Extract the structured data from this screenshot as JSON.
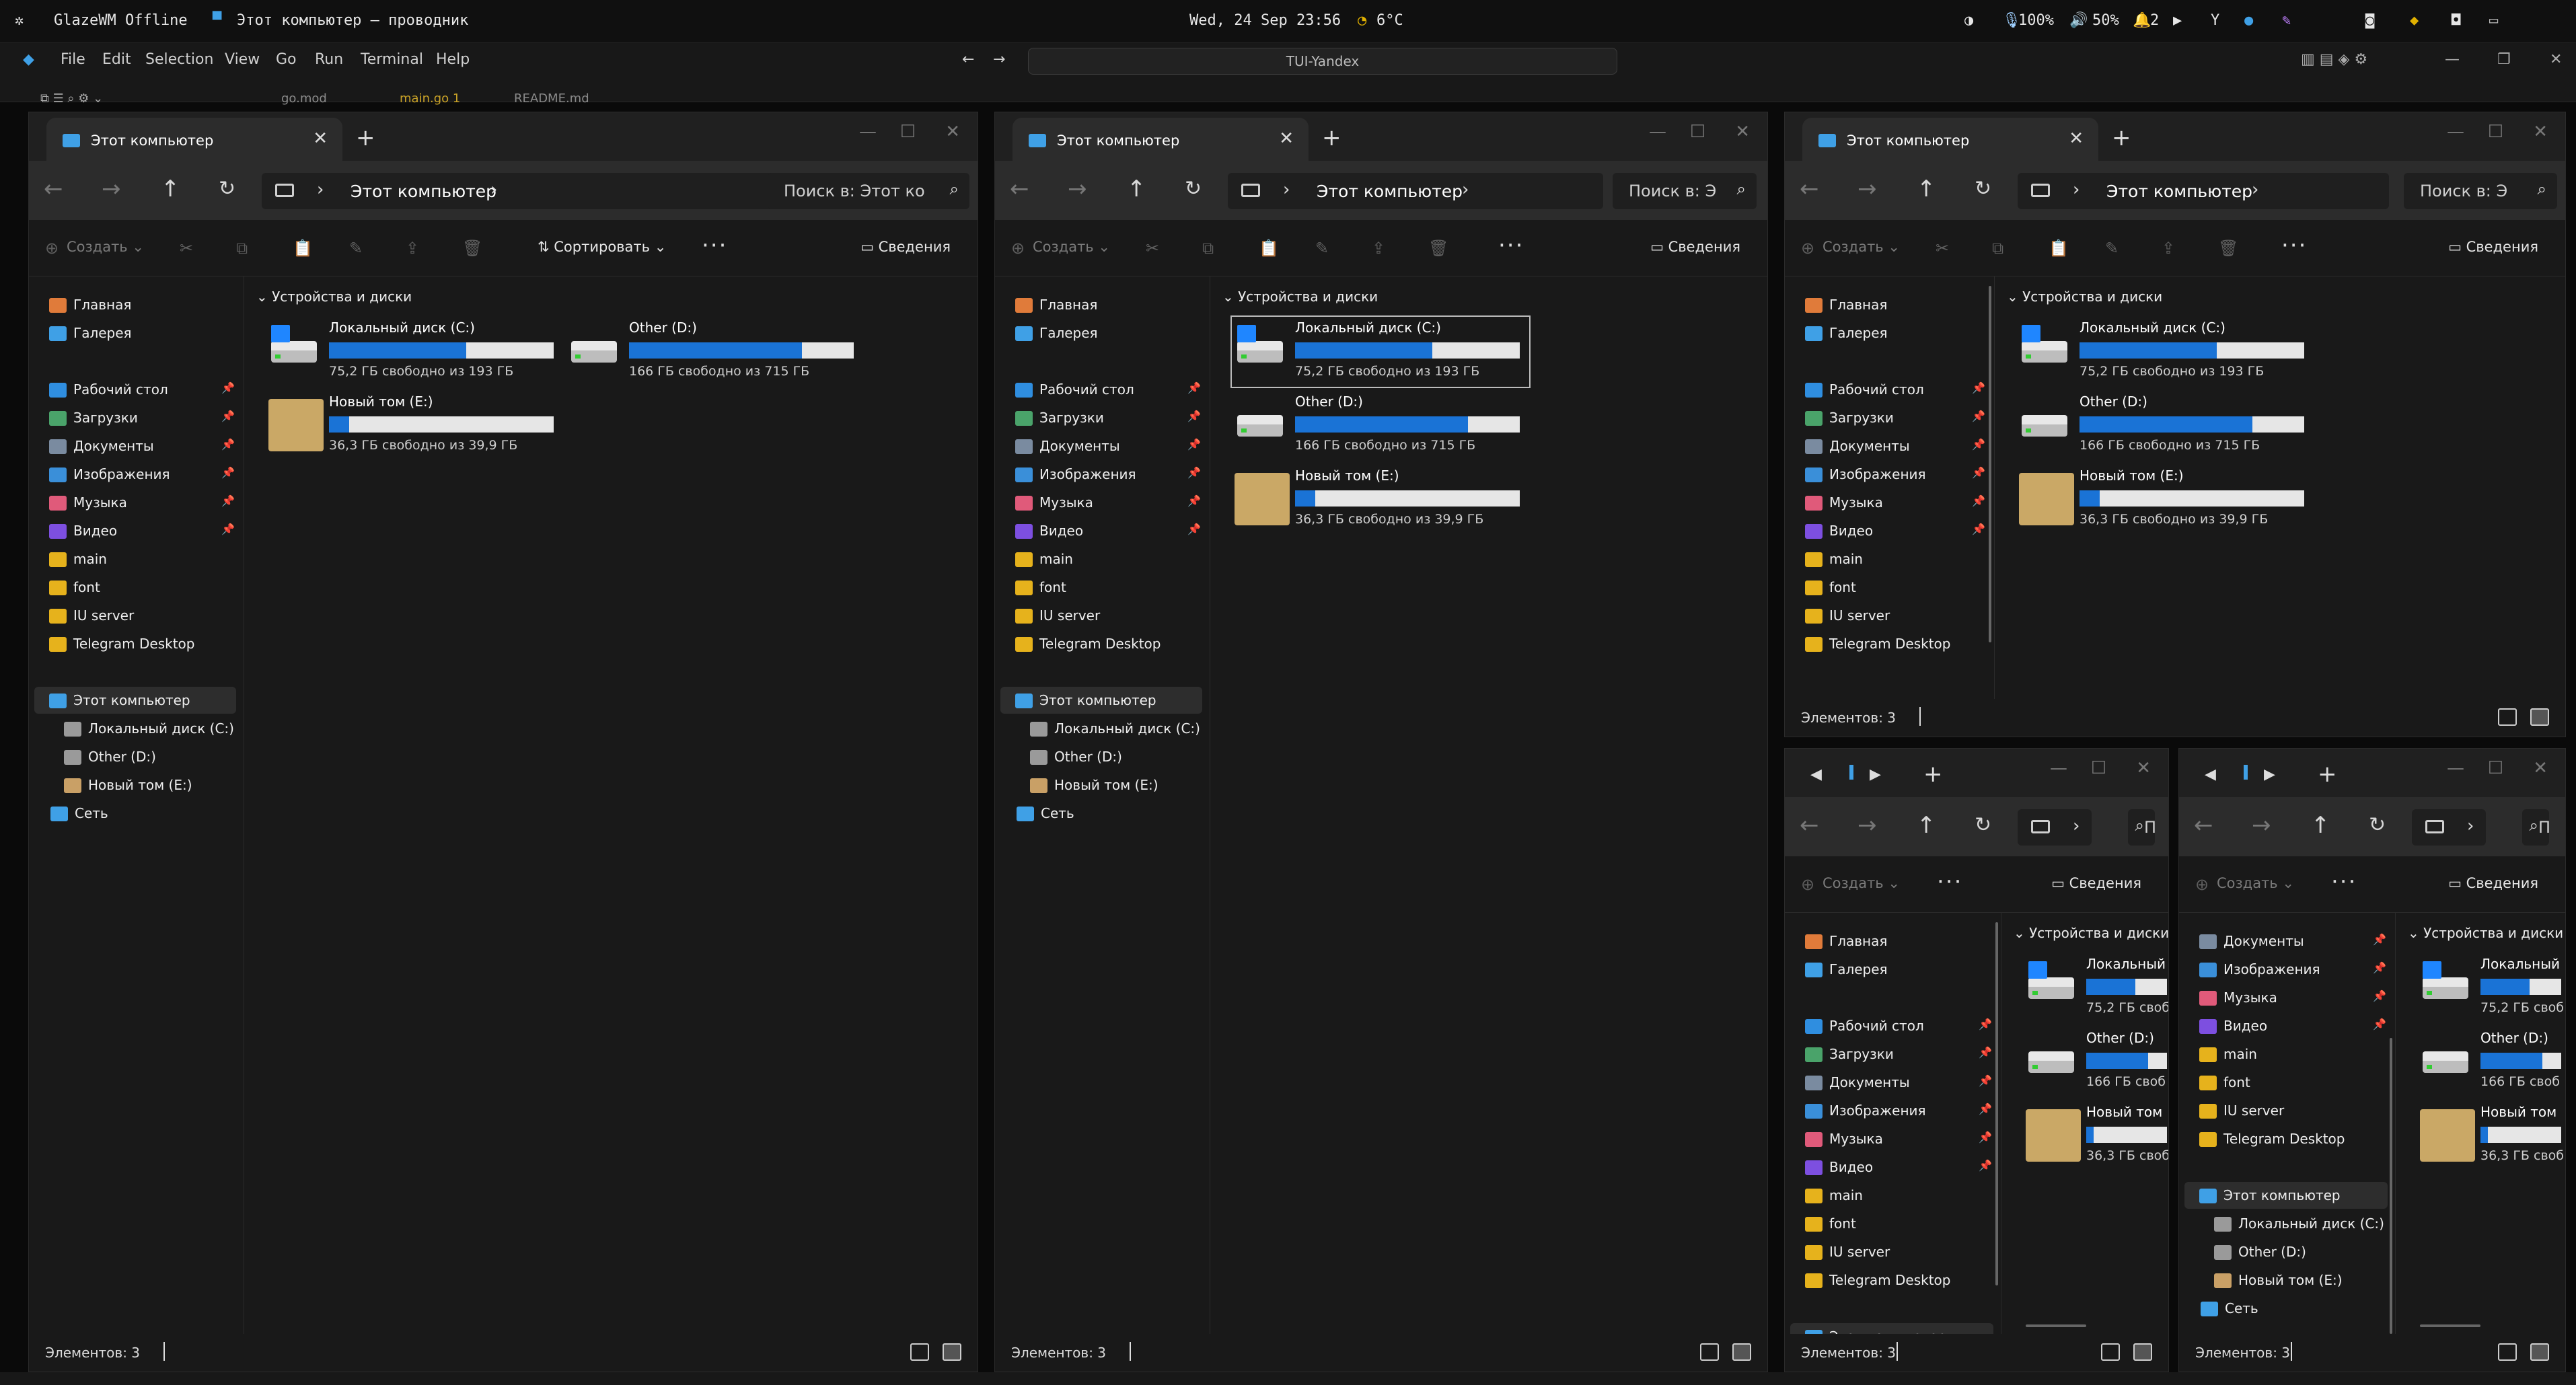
{
  "topbar": {
    "glaze": "GlazeWM Offline",
    "window_title": "Этот компьютер — проводник",
    "datetime": "Wed, 24 Sep 23:56",
    "weather": "6°C",
    "mic": "100%",
    "volume": "50%",
    "notifications": "2"
  },
  "vscode": {
    "menu": [
      "File",
      "Edit",
      "Selection",
      "View",
      "Go",
      "Run",
      "Terminal",
      "Help"
    ],
    "command_center": "TUI-Yandex",
    "tabs": [
      "go.mod",
      "main.go 1",
      "README.md"
    ]
  },
  "explorer": {
    "tab_title": "Этот компьютер",
    "breadcrumb": "Этот компьютер",
    "search_placeholder": "Поиск в: Этот ко",
    "search_short": "Поиск в: Э",
    "create": "Создать",
    "sort": "Сортировать",
    "details": "Сведения",
    "group": "Устройства и диски",
    "status": "Элементов: 3",
    "sidebar": [
      "Главная",
      "Галерея",
      "Рабочий стол",
      "Загрузки",
      "Документы",
      "Изображения",
      "Музыка",
      "Видео",
      "main",
      "font",
      "IU server",
      "Telegram Desktop",
      "Этот компьютер",
      "Локальный диск (C:)",
      "Other (D:)",
      "Новый том (E:)",
      "Сеть"
    ],
    "drives": [
      {
        "name": "Локальный диск (C:)",
        "short": "Локальный",
        "free": "75,2 ГБ свободно из 193 ГБ",
        "free_short": "75,2 ГБ своб",
        "used": 0.61
      },
      {
        "name": "Other (D:)",
        "short": "Other (D:)",
        "free": "166 ГБ свободно из 715 ГБ",
        "free_short": "166 ГБ своб",
        "used": 0.77
      },
      {
        "name": "Новый том (E:)",
        "short": "Новый том",
        "free": "36,3 ГБ свободно из 39,9 ГБ",
        "free_short": "36,3 ГБ своб",
        "used": 0.09
      }
    ]
  },
  "colors": {
    "accent": "#1a73d6",
    "bar_bg": "#e6e6e6",
    "window": "#191919"
  }
}
